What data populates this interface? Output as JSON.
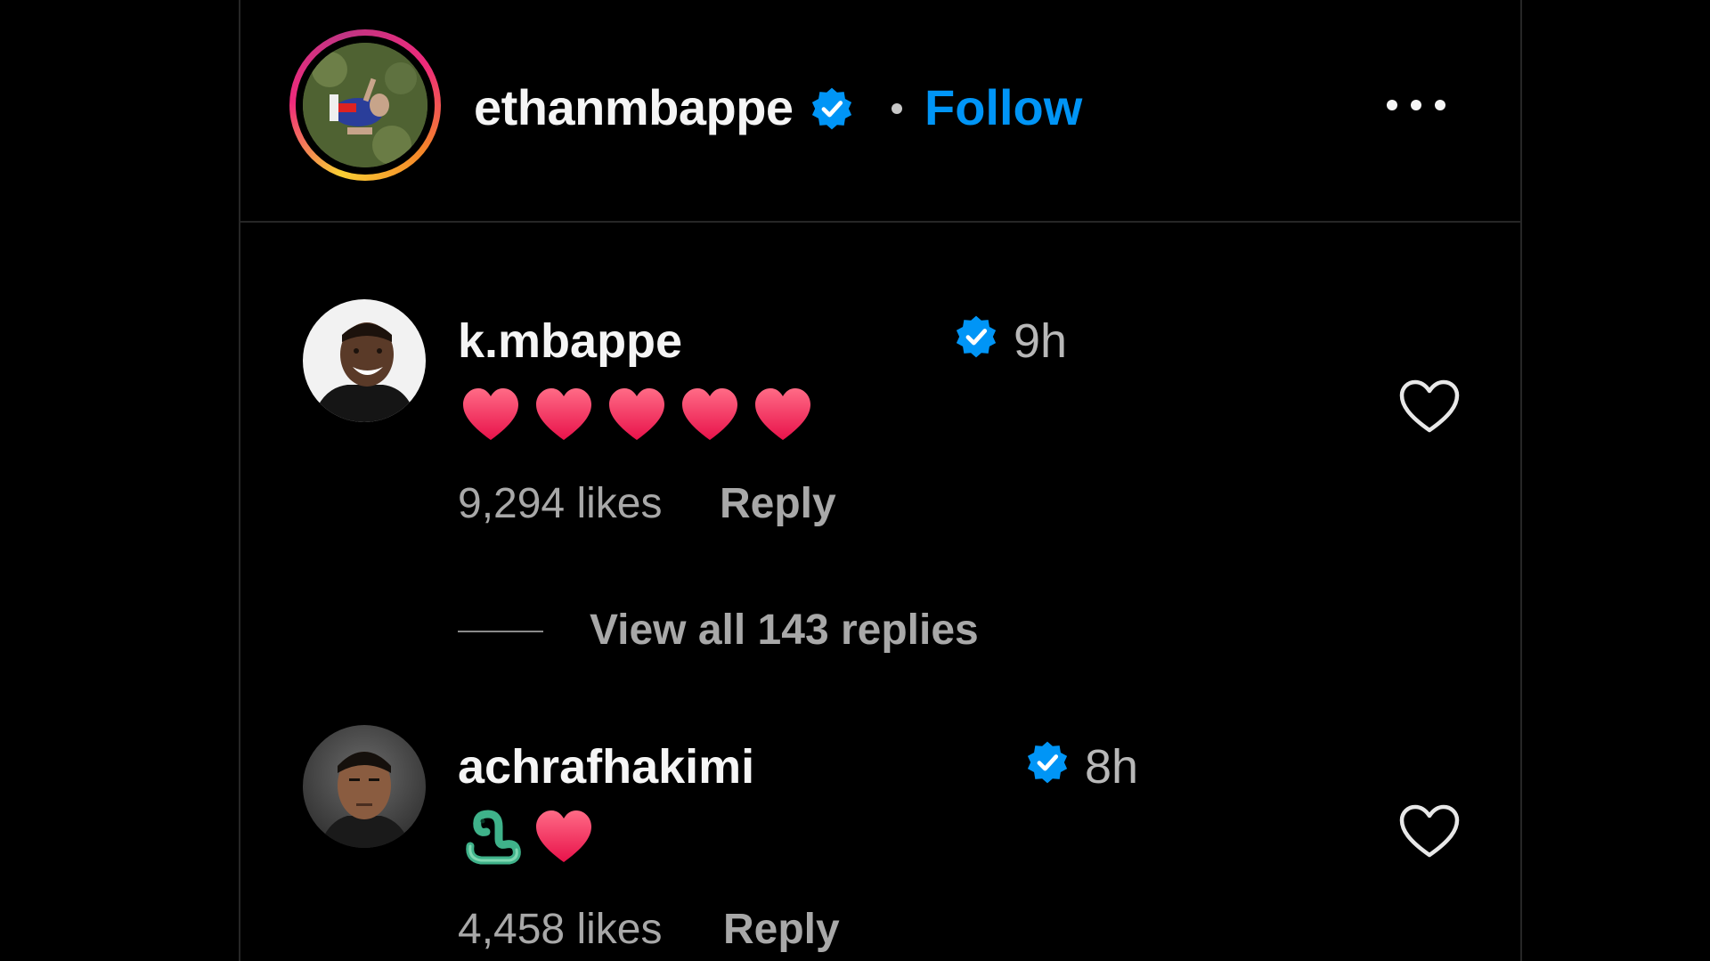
{
  "post": {
    "author": "ethanmbappe",
    "follow_label": "Follow",
    "separator": "•",
    "more_icon": "more-horizontal-icon"
  },
  "comments": [
    {
      "username": "k.mbappe",
      "time": "9h",
      "content_emoji": [
        "heart",
        "heart",
        "heart",
        "heart",
        "heart"
      ],
      "likes": "9,294 likes",
      "reply_label": "Reply"
    },
    {
      "username": "achrafhakimi",
      "time": "8h",
      "content_emoji": [
        "snake",
        "heart"
      ],
      "likes": "4,458 likes",
      "reply_label": "Reply"
    }
  ],
  "view_replies": {
    "label": "View all 143 replies"
  },
  "colors": {
    "background": "#000000",
    "accent_blue": "#0095f6",
    "verified_blue": "#0095f6",
    "heart_red": "#ff3b5c",
    "muted_text": "#a8a8a8",
    "divider": "#262626"
  }
}
